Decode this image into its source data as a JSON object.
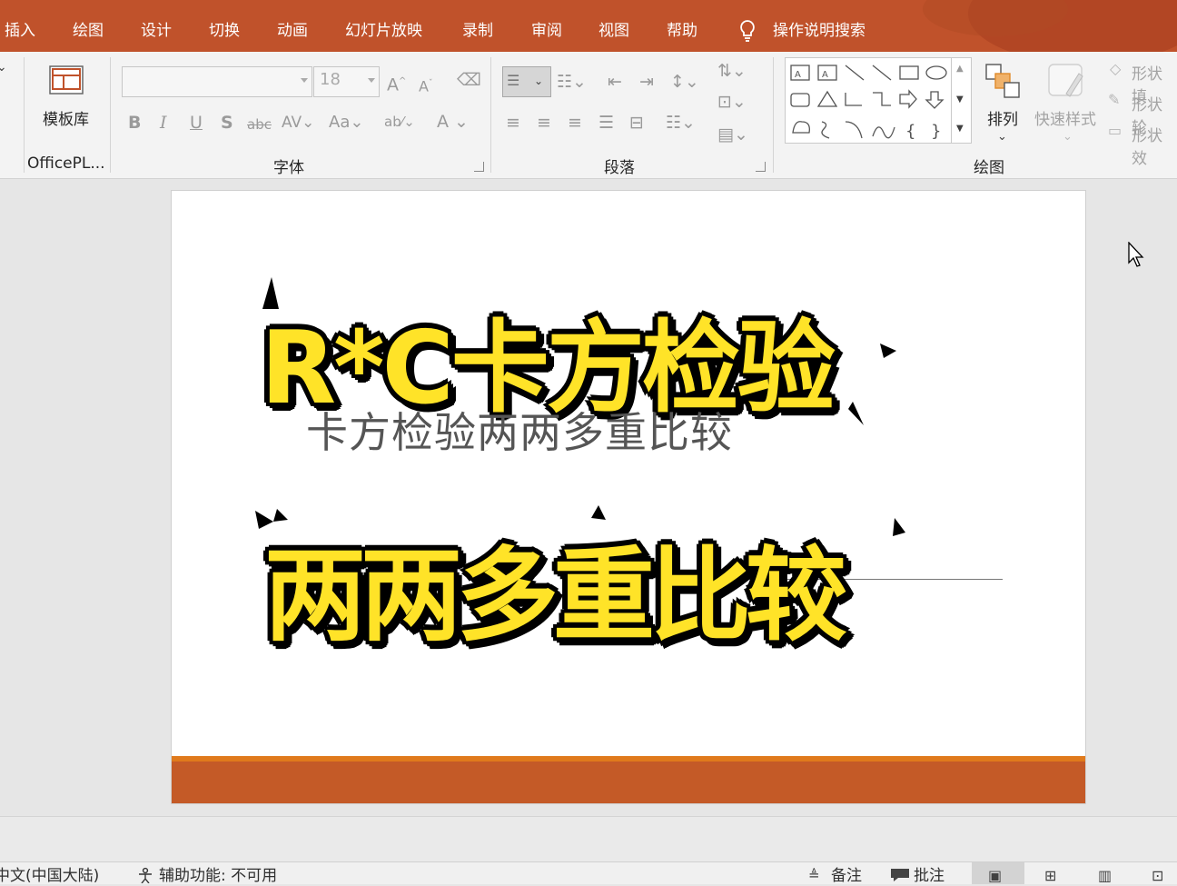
{
  "menu": {
    "tabs": [
      "插入",
      "绘图",
      "设计",
      "切换",
      "动画",
      "幻灯片放映",
      "录制",
      "审阅",
      "视图",
      "帮助"
    ],
    "search_label": "操作说明搜索"
  },
  "ribbon": {
    "templates": {
      "button_label": "模板库",
      "group_label": "OfficePL..."
    },
    "font": {
      "group_label": "字体",
      "font_size": "18"
    },
    "paragraph": {
      "group_label": "段落"
    },
    "drawing": {
      "group_label": "绘图",
      "arrange_label": "排列",
      "quick_styles_label": "快速样式",
      "shape_fill": "形状填",
      "shape_outline": "形状轮",
      "shape_effects": "形状效"
    }
  },
  "slide": {
    "title_line1": "R*C卡方检验",
    "subtitle_ghost": "卡方检验两两多重比较",
    "title_line2": "两两多重比较"
  },
  "status": {
    "language": "中文(中国大陆)",
    "accessibility": "辅助功能: 不可用",
    "notes": "备注",
    "comments": "批注"
  },
  "colors": {
    "menubar": "#c0522b",
    "accent_band": "#c45a27",
    "title_yellow": "#ffe328"
  }
}
